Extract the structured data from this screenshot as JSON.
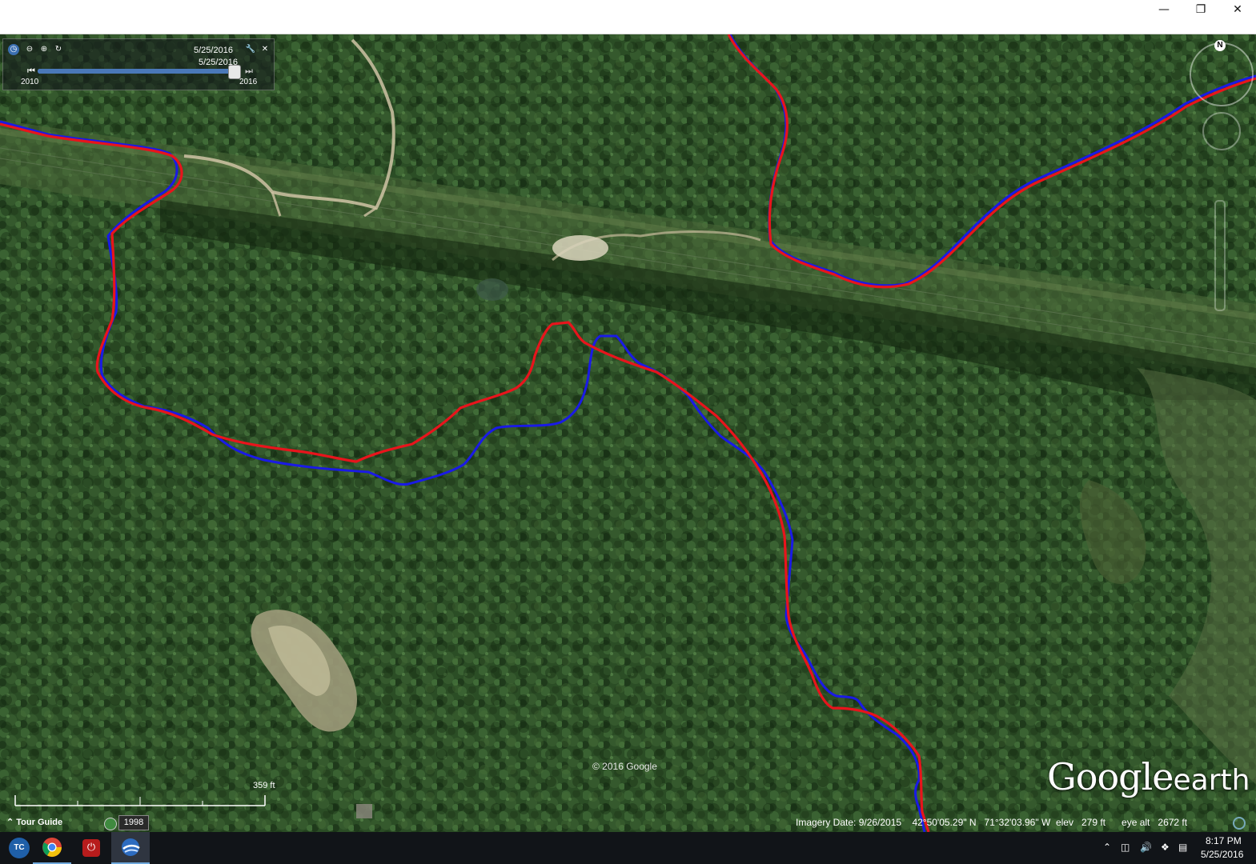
{
  "window": {
    "minimize_icon": "minimize-icon",
    "maximize_icon": "restore-icon",
    "close_icon": "close-icon"
  },
  "time_slider": {
    "current_date": "5/25/2016",
    "thumb_date": "5/25/2016",
    "start_year": "2010",
    "end_year": "2016",
    "position": 1.0
  },
  "map": {
    "copyright": "© 2016 Google",
    "scale_label": "359 ft",
    "compass_label": "N",
    "logo_main": "Google",
    "logo_sub": "earth",
    "track_colors": {
      "red": "#e8141c",
      "blue": "#1a1ae6"
    }
  },
  "status": {
    "tour_guide": "Tour Guide",
    "historical_year": "1998",
    "imagery_date": "Imagery Date: 9/26/2015",
    "latitude": "42°50'05.29\" N",
    "longitude": "71°32'03.96\" W",
    "elev_label": "elev",
    "elev_value": "279 ft",
    "eye_alt_label": "eye alt",
    "eye_alt_value": "2672 ft"
  },
  "taskbar": {
    "apps": [
      "tc-app-icon",
      "chrome-icon",
      "power-app-icon",
      "google-earth-icon"
    ],
    "tc_label": "TC",
    "time": "8:17 PM",
    "date": "5/25/2016"
  }
}
